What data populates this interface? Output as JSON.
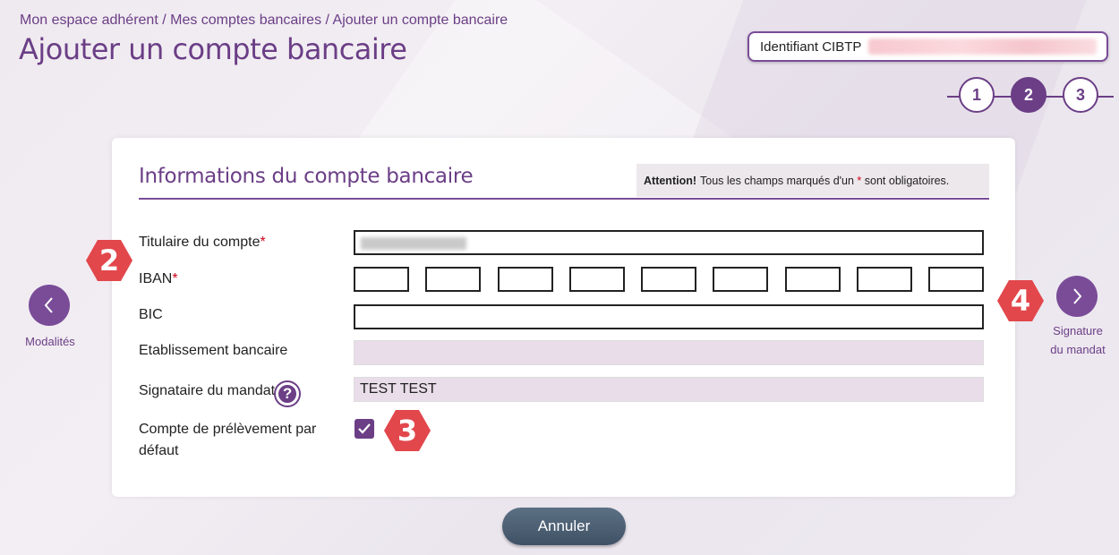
{
  "breadcrumb": "Mon espace adhérent / Mes comptes bancaires / Ajouter un compte bancaire",
  "page_title": "Ajouter un compte bancaire",
  "identifiant": {
    "label": "Identifiant CIBTP"
  },
  "steps": [
    "1",
    "2",
    "3"
  ],
  "active_step": "2",
  "card": {
    "title": "Informations du compte bancaire",
    "attention_bold": "Attention!",
    "attention_text_before": "Tous les champs marqués d'un",
    "attention_star": "*",
    "attention_text_after": "sont obligatoires."
  },
  "form": {
    "titulaire_label": "Titulaire du compte",
    "iban_label": "IBAN",
    "bic_label": "BIC",
    "etablissement_label": "Etablissement bancaire",
    "signataire_label": "Signataire du mandat",
    "signataire_value": "TEST TEST",
    "compte_label_line1": "Compte de prélèvement par",
    "compte_label_line2": "défaut",
    "required_mark": "*",
    "iban_fields": 9,
    "compte_defaut_checked": true
  },
  "nav": {
    "prev_label": "Modalités",
    "next_label_line1": "Signature",
    "next_label_line2": "du mandat"
  },
  "badges": {
    "b2": "2",
    "b3": "3",
    "b4": "4"
  },
  "cancel_button": "Annuler",
  "colors": {
    "accent": "#6b3e86",
    "badge": "#e2474c",
    "required": "#d0021b",
    "cancel_button": "#4a5c70"
  }
}
